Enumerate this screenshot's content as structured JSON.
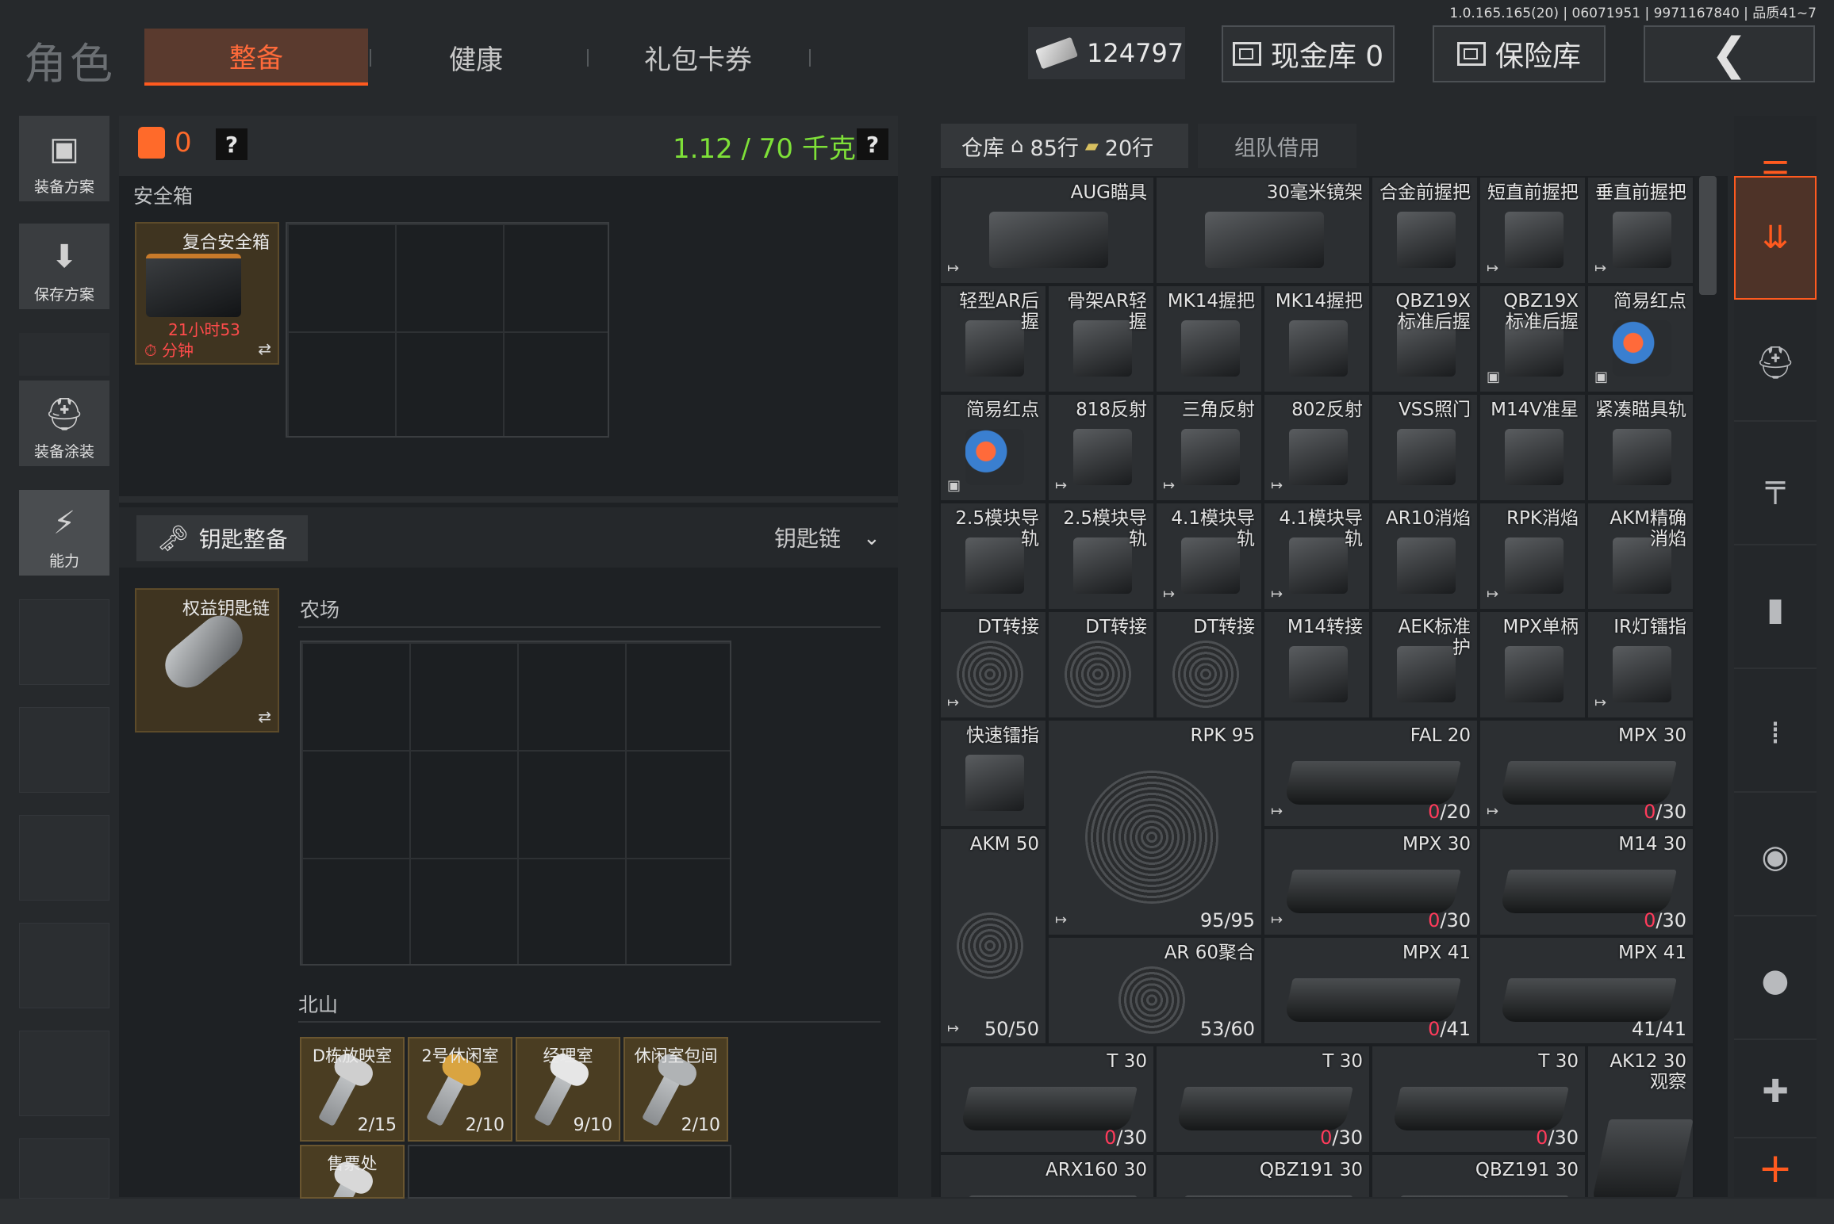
{
  "version": "1.0.165.165(20) | 06071951 | 9971167840 | 品质41~7",
  "header": {
    "role_title": "角色",
    "tabs": [
      {
        "label": "整备",
        "active": true
      },
      {
        "label": "健康",
        "active": false
      },
      {
        "label": "礼包卡券",
        "active": false
      }
    ],
    "money": "124797",
    "cash_store": "现金库 0",
    "safe_store": "保险库",
    "back_icon": "chevron-left-icon"
  },
  "sidebar": {
    "items": [
      {
        "label": "装备方案",
        "icon": "vest-icon"
      },
      {
        "label": "保存方案",
        "icon": "download-icon"
      },
      {
        "label": "装备涂装",
        "icon": "helmet-icon"
      },
      {
        "label": "能力",
        "icon": "lightning-icon",
        "active": true
      }
    ]
  },
  "equip": {
    "bag_count": "0",
    "weight": "1.12 / 70 千克",
    "help": "?",
    "safe_label": "安全箱",
    "safe_card": {
      "name": "复合安全箱",
      "time_line1": "21小时53",
      "time_line2": "分钟"
    },
    "keychain_tab": "钥匙整备",
    "keychain_select": "钥匙链",
    "key_card": {
      "name": "权益钥匙链"
    },
    "farm_label": "农场",
    "north_label": "北山",
    "keys": [
      {
        "name": "D栋放映室",
        "count": "2/15",
        "color": "#cfcfcf"
      },
      {
        "name": "2号休闲室",
        "count": "2/10",
        "color": "#d9a441"
      },
      {
        "name": "经理室",
        "count": "9/10",
        "color": "#e6e6e6"
      },
      {
        "name": "休闲室包间",
        "count": "2/10",
        "color": "#b0b3b5"
      },
      {
        "name": "售票处",
        "count": "",
        "color": "#d8d8d8"
      }
    ]
  },
  "warehouse": {
    "tab_label": "仓库",
    "rows_home": "85行",
    "rows_extra": "20行",
    "team_label": "组队借用",
    "cells": [
      {
        "name": "AUG瞄具",
        "count": "",
        "red": "",
        "col": 0,
        "row": 0,
        "w": 2,
        "h": 1,
        "gfx": "dark",
        "tag": "↦"
      },
      {
        "name": "30毫米镜架",
        "count": "",
        "red": "",
        "col": 2,
        "row": 0,
        "w": 2,
        "h": 1,
        "gfx": "dark",
        "tag": ""
      },
      {
        "name": "合金前握把",
        "count": "",
        "red": "",
        "col": 4,
        "row": 0,
        "w": 1,
        "h": 1,
        "gfx": "dark",
        "tag": ""
      },
      {
        "name": "短直前握把",
        "count": "",
        "red": "",
        "col": 5,
        "row": 0,
        "w": 1,
        "h": 1,
        "gfx": "dark",
        "tag": "↦"
      },
      {
        "name": "垂直前握把",
        "count": "",
        "red": "",
        "col": 6,
        "row": 0,
        "w": 1,
        "h": 1,
        "gfx": "dark",
        "tag": "↦"
      },
      {
        "name": "轻型AR后\n握",
        "count": "",
        "red": "",
        "col": 0,
        "row": 1,
        "w": 1,
        "h": 1,
        "gfx": "dark",
        "tag": ""
      },
      {
        "name": "骨架AR轻\n握",
        "count": "",
        "red": "",
        "col": 1,
        "row": 1,
        "w": 1,
        "h": 1,
        "gfx": "dark",
        "tag": ""
      },
      {
        "name": "MK14握把",
        "count": "",
        "red": "",
        "col": 2,
        "row": 1,
        "w": 1,
        "h": 1,
        "gfx": "dark",
        "tag": ""
      },
      {
        "name": "MK14握把",
        "count": "",
        "red": "",
        "col": 3,
        "row": 1,
        "w": 1,
        "h": 1,
        "gfx": "dark",
        "tag": ""
      },
      {
        "name": "QBZ19X\n标准后握",
        "count": "",
        "red": "",
        "col": 4,
        "row": 1,
        "w": 1,
        "h": 1,
        "gfx": "dark",
        "tag": ""
      },
      {
        "name": "QBZ19X\n标准后握",
        "count": "",
        "red": "",
        "col": 5,
        "row": 1,
        "w": 1,
        "h": 1,
        "gfx": "dark",
        "tag": "▣"
      },
      {
        "name": "简易红点",
        "count": "",
        "red": "",
        "col": 6,
        "row": 1,
        "w": 1,
        "h": 1,
        "gfx": "red",
        "tag": "▣"
      },
      {
        "name": "简易红点",
        "count": "",
        "red": "",
        "col": 0,
        "row": 2,
        "w": 1,
        "h": 1,
        "gfx": "red",
        "tag": "▣"
      },
      {
        "name": "818反射",
        "count": "",
        "red": "",
        "col": 1,
        "row": 2,
        "w": 1,
        "h": 1,
        "gfx": "dark",
        "tag": "↦"
      },
      {
        "name": "三角反射",
        "count": "",
        "red": "",
        "col": 2,
        "row": 2,
        "w": 1,
        "h": 1,
        "gfx": "dark",
        "tag": "↦"
      },
      {
        "name": "802反射",
        "count": "",
        "red": "",
        "col": 3,
        "row": 2,
        "w": 1,
        "h": 1,
        "gfx": "dark",
        "tag": "↦"
      },
      {
        "name": "VSS照门",
        "count": "",
        "red": "",
        "col": 4,
        "row": 2,
        "w": 1,
        "h": 1,
        "gfx": "dark",
        "tag": ""
      },
      {
        "name": "M14V准星",
        "count": "",
        "red": "",
        "col": 5,
        "row": 2,
        "w": 1,
        "h": 1,
        "gfx": "dark",
        "tag": ""
      },
      {
        "name": "紧凑瞄具轨",
        "count": "",
        "red": "",
        "col": 6,
        "row": 2,
        "w": 1,
        "h": 1,
        "gfx": "dark",
        "tag": ""
      },
      {
        "name": "2.5模块导\n轨",
        "count": "",
        "red": "",
        "col": 0,
        "row": 3,
        "w": 1,
        "h": 1,
        "gfx": "dark",
        "tag": ""
      },
      {
        "name": "2.5模块导\n轨",
        "count": "",
        "red": "",
        "col": 1,
        "row": 3,
        "w": 1,
        "h": 1,
        "gfx": "dark",
        "tag": ""
      },
      {
        "name": "4.1模块导\n轨",
        "count": "",
        "red": "",
        "col": 2,
        "row": 3,
        "w": 1,
        "h": 1,
        "gfx": "dark",
        "tag": "↦"
      },
      {
        "name": "4.1模块导\n轨",
        "count": "",
        "red": "",
        "col": 3,
        "row": 3,
        "w": 1,
        "h": 1,
        "gfx": "dark",
        "tag": "↦"
      },
      {
        "name": "AR10消焰",
        "count": "",
        "red": "",
        "col": 4,
        "row": 3,
        "w": 1,
        "h": 1,
        "gfx": "dark",
        "tag": ""
      },
      {
        "name": "RPK消焰",
        "count": "",
        "red": "",
        "col": 5,
        "row": 3,
        "w": 1,
        "h": 1,
        "gfx": "dark",
        "tag": "↦"
      },
      {
        "name": "AKM精确\n消焰",
        "count": "",
        "red": "",
        "col": 6,
        "row": 3,
        "w": 1,
        "h": 1,
        "gfx": "dark",
        "tag": ""
      },
      {
        "name": "DT转接",
        "count": "",
        "red": "",
        "col": 0,
        "row": 4,
        "w": 1,
        "h": 1,
        "gfx": "ring",
        "tag": "↦"
      },
      {
        "name": "DT转接",
        "count": "",
        "red": "",
        "col": 1,
        "row": 4,
        "w": 1,
        "h": 1,
        "gfx": "ring",
        "tag": ""
      },
      {
        "name": "DT转接",
        "count": "",
        "red": "",
        "col": 2,
        "row": 4,
        "w": 1,
        "h": 1,
        "gfx": "ring",
        "tag": ""
      },
      {
        "name": "M14转接",
        "count": "",
        "red": "",
        "col": 3,
        "row": 4,
        "w": 1,
        "h": 1,
        "gfx": "dark",
        "tag": ""
      },
      {
        "name": "AEK标准\n护",
        "count": "",
        "red": "",
        "col": 4,
        "row": 4,
        "w": 1,
        "h": 1,
        "gfx": "dark",
        "tag": ""
      },
      {
        "name": "MPX单柄",
        "count": "",
        "red": "",
        "col": 5,
        "row": 4,
        "w": 1,
        "h": 1,
        "gfx": "dark",
        "tag": ""
      },
      {
        "name": "IR灯镭指",
        "count": "",
        "red": "",
        "col": 6,
        "row": 4,
        "w": 1,
        "h": 1,
        "gfx": "dark",
        "tag": "↦"
      },
      {
        "name": "快速镭指",
        "count": "",
        "red": "",
        "col": 0,
        "row": 5,
        "w": 1,
        "h": 1,
        "gfx": "dark",
        "tag": ""
      },
      {
        "name": "RPK 95",
        "count": "95/95",
        "red": "",
        "col": 1,
        "row": 5,
        "w": 2,
        "h": 2,
        "gfx": "ring",
        "tag": "↦"
      },
      {
        "name": "FAL 20",
        "count": "/20",
        "red": "0",
        "col": 3,
        "row": 5,
        "w": 2,
        "h": 1,
        "gfx": "mag",
        "tag": "↦"
      },
      {
        "name": "MPX 30",
        "count": "/30",
        "red": "0",
        "col": 5,
        "row": 5,
        "w": 2,
        "h": 1,
        "gfx": "mag",
        "tag": "↦"
      },
      {
        "name": "AKM 50",
        "count": "50/50",
        "red": "",
        "col": 0,
        "row": 6,
        "w": 1,
        "h": 2,
        "gfx": "ring",
        "tag": "↦"
      },
      {
        "name": "MPX 30",
        "count": "/30",
        "red": "0",
        "col": 3,
        "row": 6,
        "w": 2,
        "h": 1,
        "gfx": "mag",
        "tag": "↦"
      },
      {
        "name": "M14 30",
        "count": "/30",
        "red": "0",
        "col": 5,
        "row": 6,
        "w": 2,
        "h": 1,
        "gfx": "mag",
        "tag": ""
      },
      {
        "name": "AR 60聚合",
        "count": "53/60",
        "red": "",
        "col": 1,
        "row": 7,
        "w": 2,
        "h": 1,
        "gfx": "ring",
        "tag": ""
      },
      {
        "name": "MPX 41",
        "count": "/41",
        "red": "0",
        "col": 3,
        "row": 7,
        "w": 2,
        "h": 1,
        "gfx": "mag",
        "tag": ""
      },
      {
        "name": "MPX 41",
        "count": "41/41",
        "red": "",
        "col": 5,
        "row": 7,
        "w": 2,
        "h": 1,
        "gfx": "mag",
        "tag": ""
      },
      {
        "name": "T 30",
        "count": "/30",
        "red": "0",
        "col": 0,
        "row": 8,
        "w": 2,
        "h": 1,
        "gfx": "mag",
        "tag": ""
      },
      {
        "name": "T 30",
        "count": "/30",
        "red": "0",
        "col": 2,
        "row": 8,
        "w": 2,
        "h": 1,
        "gfx": "mag",
        "tag": ""
      },
      {
        "name": "T 30",
        "count": "/30",
        "red": "0",
        "col": 4,
        "row": 8,
        "w": 2,
        "h": 1,
        "gfx": "mag",
        "tag": ""
      },
      {
        "name": "AK12 30\n观察",
        "count": "",
        "red": "",
        "col": 6,
        "row": 8,
        "w": 1,
        "h": 2,
        "gfx": "mag",
        "tag": ""
      },
      {
        "name": "ARX160 30",
        "count": "",
        "red": "",
        "col": 0,
        "row": 9,
        "w": 2,
        "h": 1,
        "gfx": "mag",
        "tag": ""
      },
      {
        "name": "QBZ191 30",
        "count": "",
        "red": "",
        "col": 2,
        "row": 9,
        "w": 2,
        "h": 1,
        "gfx": "mag",
        "tag": ""
      },
      {
        "name": "QBZ191 30",
        "count": "",
        "red": "",
        "col": 4,
        "row": 9,
        "w": 2,
        "h": 1,
        "gfx": "mag",
        "tag": ""
      }
    ]
  },
  "right_sidebar": {
    "icons": [
      "stack-refresh-icon",
      "stack-download-icon",
      "helmet-icon",
      "rifle-icon",
      "magazine-icon",
      "bullet-icon",
      "sight-icon",
      "grenade-icon",
      "medkit-icon",
      "plus-icon"
    ]
  },
  "colors": {
    "accent": "#ff5a1f",
    "green": "#7ee038",
    "red_count": "#ff3b5b"
  }
}
